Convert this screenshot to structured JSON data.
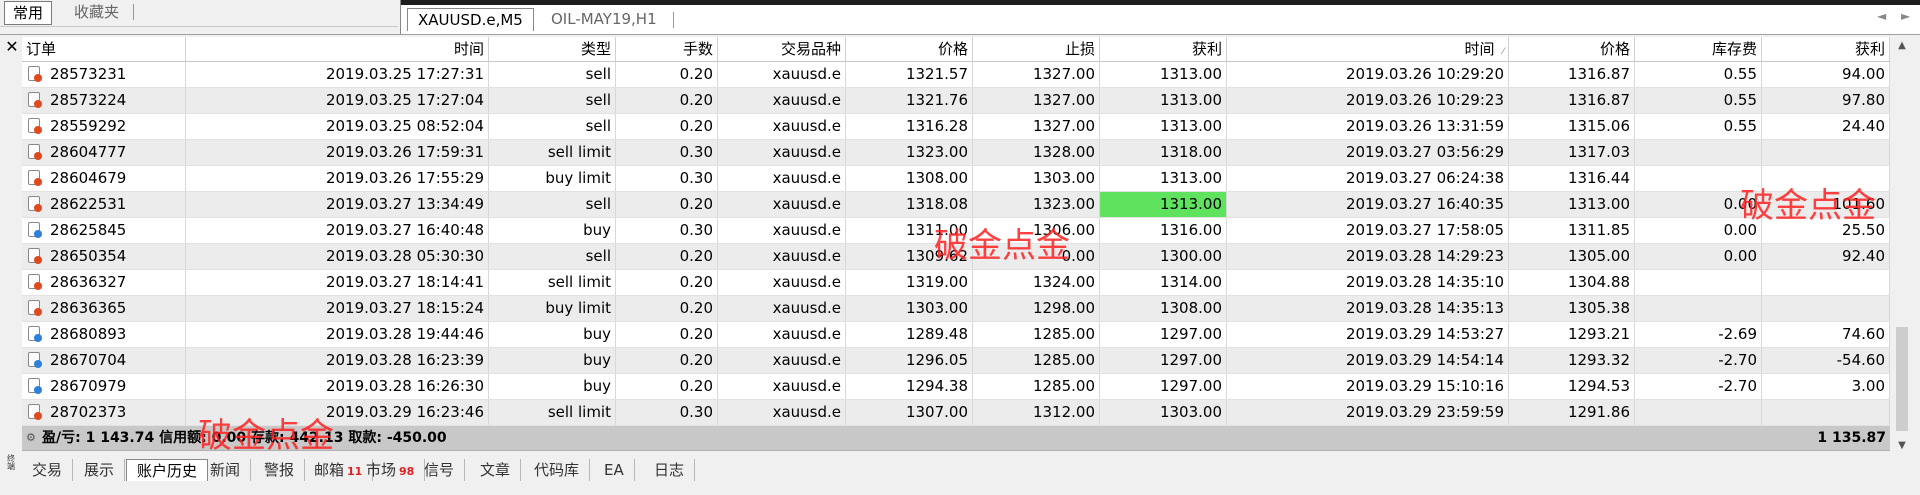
{
  "top_left_tabs": [
    "常用",
    "收藏夹"
  ],
  "chart_tabs": [
    "XAUUSD.e,M5",
    "OIL-MAY19,H1"
  ],
  "nav_arrows": [
    "◄",
    "►"
  ],
  "close_glyph": "✕",
  "terminal_label": "终端",
  "columns": [
    "订单",
    "时间",
    "类型",
    "手数",
    "交易品种",
    "价格",
    "止损",
    "获利",
    "时间",
    "价格",
    "库存费",
    "获利"
  ],
  "rows": [
    {
      "order": "28573231",
      "open_time": "2019.03.25 17:27:31",
      "type": "sell",
      "lots": "0.20",
      "symbol": "xauusd.e",
      "price": "1321.57",
      "sl": "1327.00",
      "tp": "1313.00",
      "close_time": "2019.03.26 10:29:20",
      "close_price": "1316.87",
      "swap": "0.55",
      "profit": "94.00",
      "icon": "sell-order-icon"
    },
    {
      "order": "28573224",
      "open_time": "2019.03.25 17:27:04",
      "type": "sell",
      "lots": "0.20",
      "symbol": "xauusd.e",
      "price": "1321.76",
      "sl": "1327.00",
      "tp": "1313.00",
      "close_time": "2019.03.26 10:29:23",
      "close_price": "1316.87",
      "swap": "0.55",
      "profit": "97.80",
      "icon": "sell-order-icon"
    },
    {
      "order": "28559292",
      "open_time": "2019.03.25 08:52:04",
      "type": "sell",
      "lots": "0.20",
      "symbol": "xauusd.e",
      "price": "1316.28",
      "sl": "1327.00",
      "tp": "1313.00",
      "close_time": "2019.03.26 13:31:59",
      "close_price": "1315.06",
      "swap": "0.55",
      "profit": "24.40",
      "icon": "sell-order-icon"
    },
    {
      "order": "28604777",
      "open_time": "2019.03.26 17:59:31",
      "type": "sell limit",
      "lots": "0.30",
      "symbol": "xauusd.e",
      "price": "1323.00",
      "sl": "1328.00",
      "tp": "1318.00",
      "close_time": "2019.03.27 03:56:29",
      "close_price": "1317.03",
      "swap": "",
      "profit": "",
      "icon": "sell-order-icon"
    },
    {
      "order": "28604679",
      "open_time": "2019.03.26 17:55:29",
      "type": "buy limit",
      "lots": "0.30",
      "symbol": "xauusd.e",
      "price": "1308.00",
      "sl": "1303.00",
      "tp": "1313.00",
      "close_time": "2019.03.27 06:24:38",
      "close_price": "1316.44",
      "swap": "",
      "profit": "",
      "icon": "sell-order-icon"
    },
    {
      "order": "28622531",
      "open_time": "2019.03.27 13:34:49",
      "type": "sell",
      "lots": "0.20",
      "symbol": "xauusd.e",
      "price": "1318.08",
      "sl": "1323.00",
      "tp": "1313.00",
      "close_time": "2019.03.27 16:40:35",
      "close_price": "1313.00",
      "swap": "0.00",
      "profit": "101.60",
      "icon": "sell-order-icon",
      "tp_highlight": "#5fe35f"
    },
    {
      "order": "28625845",
      "open_time": "2019.03.27 16:40:48",
      "type": "buy",
      "lots": "0.30",
      "symbol": "xauusd.e",
      "price": "1311.00",
      "sl": "1306.00",
      "tp": "1316.00",
      "close_time": "2019.03.27 17:58:05",
      "close_price": "1311.85",
      "swap": "0.00",
      "profit": "25.50",
      "icon": "buy-order-icon"
    },
    {
      "order": "28650354",
      "open_time": "2019.03.28 05:30:30",
      "type": "sell",
      "lots": "0.20",
      "symbol": "xauusd.e",
      "price": "1309.62",
      "sl": "0.00",
      "tp": "1300.00",
      "close_time": "2019.03.28 14:29:23",
      "close_price": "1305.00",
      "swap": "0.00",
      "profit": "92.40",
      "icon": "sell-order-icon"
    },
    {
      "order": "28636327",
      "open_time": "2019.03.27 18:14:41",
      "type": "sell limit",
      "lots": "0.20",
      "symbol": "xauusd.e",
      "price": "1319.00",
      "sl": "1324.00",
      "tp": "1314.00",
      "close_time": "2019.03.28 14:35:10",
      "close_price": "1304.88",
      "swap": "",
      "profit": "",
      "icon": "sell-order-icon"
    },
    {
      "order": "28636365",
      "open_time": "2019.03.27 18:15:24",
      "type": "buy limit",
      "lots": "0.20",
      "symbol": "xauusd.e",
      "price": "1303.00",
      "sl": "1298.00",
      "tp": "1308.00",
      "close_time": "2019.03.28 14:35:13",
      "close_price": "1305.38",
      "swap": "",
      "profit": "",
      "icon": "sell-order-icon"
    },
    {
      "order": "28680893",
      "open_time": "2019.03.28 19:44:46",
      "type": "buy",
      "lots": "0.20",
      "symbol": "xauusd.e",
      "price": "1289.48",
      "sl": "1285.00",
      "tp": "1297.00",
      "close_time": "2019.03.29 14:53:27",
      "close_price": "1293.21",
      "swap": "-2.69",
      "profit": "74.60",
      "icon": "buy-order-icon"
    },
    {
      "order": "28670704",
      "open_time": "2019.03.28 16:23:39",
      "type": "buy",
      "lots": "0.20",
      "symbol": "xauusd.e",
      "price": "1296.05",
      "sl": "1285.00",
      "tp": "1297.00",
      "close_time": "2019.03.29 14:54:14",
      "close_price": "1293.32",
      "swap": "-2.70",
      "profit": "-54.60",
      "icon": "buy-order-icon"
    },
    {
      "order": "28670979",
      "open_time": "2019.03.28 16:26:30",
      "type": "buy",
      "lots": "0.20",
      "symbol": "xauusd.e",
      "price": "1294.38",
      "sl": "1285.00",
      "tp": "1297.00",
      "close_time": "2019.03.29 15:10:16",
      "close_price": "1294.53",
      "swap": "-2.70",
      "profit": "3.00",
      "icon": "buy-order-icon"
    },
    {
      "order": "28702373",
      "open_time": "2019.03.29 16:23:46",
      "type": "sell limit",
      "lots": "0.30",
      "symbol": "xauusd.e",
      "price": "1307.00",
      "sl": "1312.00",
      "tp": "1303.00",
      "close_time": "2019.03.29 23:59:59",
      "close_price": "1291.86",
      "swap": "",
      "profit": "",
      "icon": "sell-order-icon"
    }
  ],
  "summary": {
    "text": "盈/亏: 1 143.74  信用额: 0.00  存款: 442.13  取款: -450.00",
    "total": "1 135.87"
  },
  "bottom_tabs": [
    {
      "label": "交易",
      "badge": ""
    },
    {
      "label": "展示",
      "badge": ""
    },
    {
      "label": "账户历史",
      "badge": "",
      "active": true
    },
    {
      "label": "新闻",
      "badge": ""
    },
    {
      "label": "警报",
      "badge": ""
    },
    {
      "label": "邮箱",
      "badge": "11"
    },
    {
      "label": "市场",
      "badge": "98"
    },
    {
      "label": "信号",
      "badge": ""
    },
    {
      "label": "文章",
      "badge": ""
    },
    {
      "label": "代码库",
      "badge": ""
    },
    {
      "label": "EA",
      "badge": ""
    },
    {
      "label": "日志",
      "badge": ""
    }
  ],
  "watermark_text": "破金点金",
  "colors": {
    "tp_highlight": "#5fe35f",
    "watermark": "#ff2020",
    "sell_dot": "#e0481e",
    "buy_dot": "#2f7fd8"
  }
}
